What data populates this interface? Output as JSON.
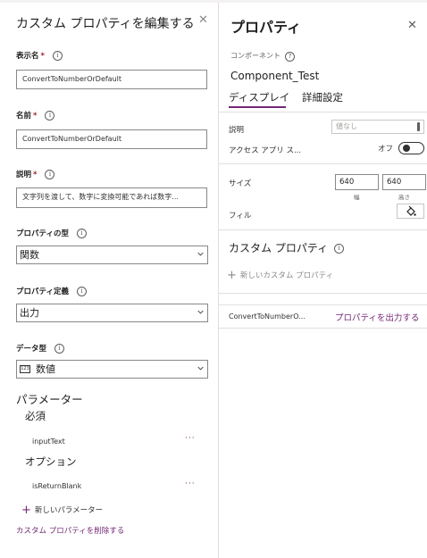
{
  "left_panel": {
    "title": "カスタム プロパティを編集する",
    "close_glyph": "✕",
    "display_name": {
      "label": "表示名",
      "required": "*",
      "value": "ConvertToNumberOrDefault"
    },
    "name": {
      "label": "名前",
      "required": "*",
      "value": "ConvertToNumberOrDefault"
    },
    "description": {
      "label": "説明",
      "required": "*",
      "value": "文字列を渡して、数字に変換可能であれば数字..."
    },
    "property_type": {
      "label": "プロパティの型",
      "value": "関数"
    },
    "property_definition": {
      "label": "プロパティ定義",
      "value": "出力"
    },
    "data_type": {
      "label": "データ型",
      "icon_text": "123",
      "value": "数値"
    },
    "parameters": {
      "heading": "パラメーター",
      "required_heading": "必須",
      "required_items": [
        "inputText"
      ],
      "optional_heading": "オプション",
      "optional_items": [
        "isReturnBlank"
      ],
      "more_glyph": "···",
      "new_label": "新しいパラメーター"
    },
    "delete_label": "カスタム プロパティを削除する"
  },
  "right_panel": {
    "title": "プロパティ",
    "close_glyph": "✕",
    "component_label": "コンポーネント",
    "component_name": "Component_Test",
    "tabs": [
      {
        "label": "ディスプレイ",
        "active": true
      },
      {
        "label": "詳細設定",
        "active": false
      }
    ],
    "description": {
      "label": "説明",
      "placeholder": "値なし"
    },
    "access_app": {
      "label": "アクセス アプリ ス...",
      "toggle_text": "オフ",
      "on": false
    },
    "size": {
      "label": "サイズ",
      "width": "640",
      "width_caption": "幅",
      "height": "640",
      "height_caption": "高さ"
    },
    "fill": {
      "label": "フィル"
    },
    "custom_properties": {
      "heading": "カスタム プロパティ",
      "new_label": "新しいカスタム プロパティ",
      "items": [
        {
          "name": "ConvertToNumberO...",
          "action": "プロパティを出力する"
        }
      ]
    }
  },
  "colors": {
    "accent": "#742774",
    "required": "#a4262c",
    "border": "#8a8886"
  },
  "icons": {
    "info": "info-icon",
    "help": "help-icon",
    "close": "close-icon",
    "chevron": "chevron-down-icon",
    "add": "plus-icon",
    "paint": "paint-bucket-icon"
  }
}
